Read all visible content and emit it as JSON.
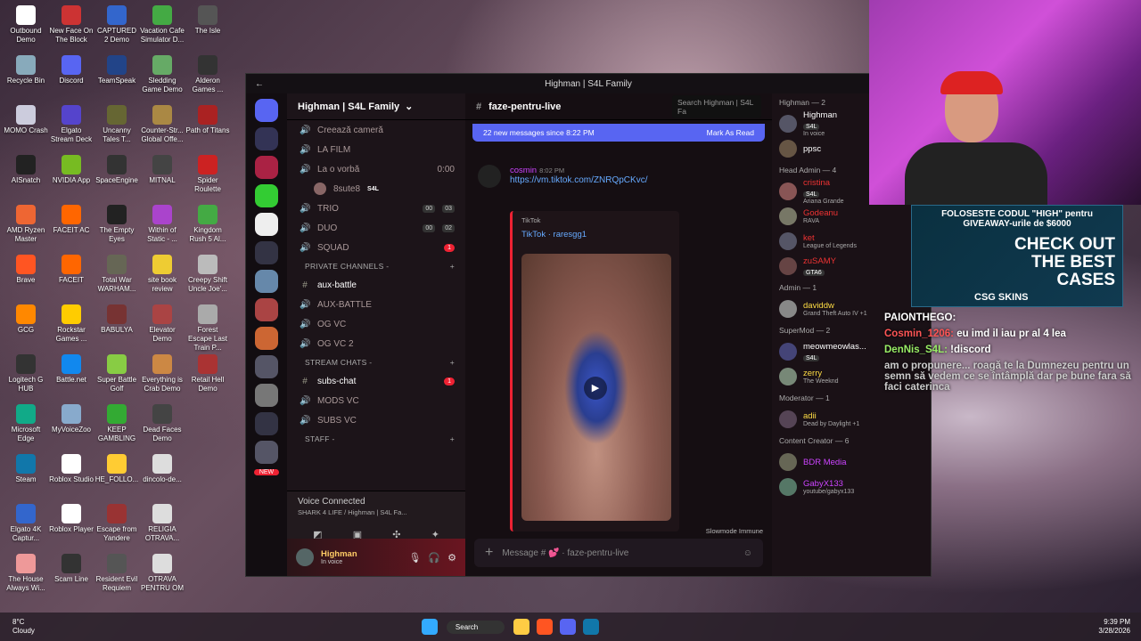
{
  "desktop": {
    "icons": [
      [
        "Outbound Demo",
        "#fff"
      ],
      [
        "New Face On The Block",
        "#c33"
      ],
      [
        "CAPTURED 2 Demo",
        "#36c"
      ],
      [
        "Vacation Cafe Simulator D...",
        "#4a4"
      ],
      [
        "The Isle",
        "#555"
      ],
      [
        "Recycle Bin",
        "#8ab"
      ],
      [
        "Discord",
        "#5865f2"
      ],
      [
        "TeamSpeak",
        "#248"
      ],
      [
        "Sledding Game Demo",
        "#6a6"
      ],
      [
        "Alderon Games ...",
        "#333"
      ],
      [
        "MOMO Crash",
        "#ccd"
      ],
      [
        "Elgato Stream Deck",
        "#54c"
      ],
      [
        "Uncanny Tales T...",
        "#663"
      ],
      [
        "Counter-Str... Global Offe...",
        "#a84"
      ],
      [
        "Path of Titans",
        "#a22"
      ],
      [
        "AISnatch",
        "#222"
      ],
      [
        "NVIDIA App",
        "#7b2"
      ],
      [
        "SpaceEngine",
        "#333"
      ],
      [
        "MITNAL",
        "#444"
      ],
      [
        "Spider Roulette",
        "#c22"
      ],
      [
        "AMD Ryzen Master",
        "#e63"
      ],
      [
        "FACEIT AC",
        "#f60"
      ],
      [
        "The Empty Eyes",
        "#222"
      ],
      [
        "Within of Static - ...",
        "#a4c"
      ],
      [
        "Kingdom Rush 5 Al...",
        "#4a4"
      ],
      [
        "Brave",
        "#f52"
      ],
      [
        "FACEIT",
        "#f60"
      ],
      [
        "Total War WARHAM...",
        "#665"
      ],
      [
        "site book review",
        "#ec3"
      ],
      [
        "Creepy Shift Uncle Joe'...",
        "#bbb"
      ],
      [
        "GCG",
        "#f80"
      ],
      [
        "Rockstar Games ...",
        "#fc0"
      ],
      [
        "BABULYA",
        "#733"
      ],
      [
        "Elevator Demo",
        "#a44"
      ],
      [
        "Forest Escape Last Train P...",
        "#aaa"
      ],
      [
        "Logitech G HUB",
        "#333"
      ],
      [
        "Battle.net",
        "#18e"
      ],
      [
        "Super Battle Golf",
        "#8c4"
      ],
      [
        "Everything is Crab Demo",
        "#c84"
      ],
      [
        "Retail Hell Demo",
        "#a33"
      ],
      [
        "Microsoft Edge",
        "#1a8"
      ],
      [
        "MyVoiceZoo",
        "#8ac"
      ],
      [
        "KEEP GAMBLING",
        "#3a3"
      ],
      [
        "Dead Faces Demo",
        "#444"
      ],
      [
        "",
        ""
      ],
      [
        "Steam",
        "#17a"
      ],
      [
        "Roblox Studio",
        "#fff"
      ],
      [
        "HE_FOLLO...",
        "#fc3"
      ],
      [
        "dincolo-de...",
        "#ddd"
      ],
      [
        "",
        ""
      ],
      [
        "Elgato 4K Captur...",
        "#36c"
      ],
      [
        "Roblox Player",
        "#fff"
      ],
      [
        "Escape from Yandere",
        "#933"
      ],
      [
        "RELIGIA OTRAVA...",
        "#ddd"
      ],
      [
        "",
        ""
      ],
      [
        "The House Always Wi...",
        "#e99"
      ],
      [
        "Scam Line",
        "#333"
      ],
      [
        "Resident Evil Requiem",
        "#555"
      ],
      [
        "OTRAVA PENTRU OM",
        "#ddd"
      ],
      [
        "",
        ""
      ]
    ]
  },
  "window": {
    "title": "Highman | S4L Family"
  },
  "server": {
    "name": "Highman | S4L Family",
    "new_label": "NEW"
  },
  "channels": [
    {
      "t": "ch",
      "name": "Creează cameră",
      "icon": "🔊"
    },
    {
      "t": "ch",
      "name": "LA FILM",
      "icon": "🔊"
    },
    {
      "t": "ch",
      "name": "La o vorbă",
      "icon": "🔊",
      "time": "0:00"
    },
    {
      "t": "user",
      "name": "8sute8",
      "tag": "S4L"
    },
    {
      "t": "ch",
      "name": "TRIO",
      "icon": "🔊",
      "p1": "00",
      "p2": "03"
    },
    {
      "t": "ch",
      "name": "DUO",
      "icon": "🔊",
      "p1": "00",
      "p2": "02"
    },
    {
      "t": "ch",
      "name": "SQUAD",
      "icon": "🔊",
      "badge": "1"
    },
    {
      "t": "cat",
      "name": "PRIVATE CHANNELS -"
    },
    {
      "t": "ch",
      "name": "aux-battle",
      "icon": "#",
      "bold": true
    },
    {
      "t": "ch",
      "name": "AUX-BATTLE",
      "icon": "🔊"
    },
    {
      "t": "ch",
      "name": "OG VC",
      "icon": "🔊"
    },
    {
      "t": "ch",
      "name": "OG VC 2",
      "icon": "🔊"
    },
    {
      "t": "cat",
      "name": "STREAM CHATS -"
    },
    {
      "t": "ch",
      "name": "subs-chat",
      "icon": "#",
      "bold": true,
      "badge": "1"
    },
    {
      "t": "ch",
      "name": "MODS VC",
      "icon": "🔊"
    },
    {
      "t": "ch",
      "name": "SUBS VC",
      "icon": "🔊"
    },
    {
      "t": "cat",
      "name": "STAFF -"
    }
  ],
  "voice": {
    "status": "Voice Connected",
    "detail": "SHARK 4 LIFE / Highman | S4L Fa..."
  },
  "me": {
    "name": "Highman",
    "status": "In voice"
  },
  "chat": {
    "channel": "faze-pentru-live",
    "search": "Search Highman | S4L Fa",
    "new_messages": "22 new messages since 8:22 PM",
    "mark_read": "Mark As Read",
    "author": "cosmin",
    "time": "8:02 PM",
    "link": "https://vm.tiktok.com/ZNRQpCKvc/",
    "embed_provider": "TikTok",
    "embed_title": "TikTok · raresgg1",
    "slowmode": "Slowmode Immune",
    "placeholder": "Message # 💕 · faze-pentru-live"
  },
  "members": [
    {
      "t": "h",
      "name": "Highman — 2"
    },
    {
      "name": "Highman",
      "sub": "In voice",
      "c": "#fff",
      "tag": "S4L"
    },
    {
      "name": "ppsc",
      "sub": "",
      "c": "#fff"
    },
    {
      "t": "h",
      "name": "Head Admin — 4"
    },
    {
      "name": "cristina",
      "sub": "Ariana Grande",
      "c": "#e33",
      "tag": "S4L"
    },
    {
      "name": "Godeanu",
      "sub": "RAVA",
      "c": "#e33"
    },
    {
      "name": "ket",
      "sub": "League of Legends",
      "c": "#e33"
    },
    {
      "name": "zuSAMY",
      "sub": "",
      "c": "#e33",
      "tag": "GTA6"
    },
    {
      "t": "h",
      "name": "Admin — 1"
    },
    {
      "name": "daviddw",
      "sub": "Grand Theft Auto IV +1",
      "c": "#fd4"
    },
    {
      "t": "h",
      "name": "SuperMod — 2"
    },
    {
      "name": "meowmeowlas...",
      "sub": "",
      "c": "#fff",
      "tag": "S4L"
    },
    {
      "name": "zerry",
      "sub": "The Weeknd",
      "c": "#fd4"
    },
    {
      "t": "h",
      "name": "Moderator — 1"
    },
    {
      "name": "adii",
      "sub": "Dead by Daylight +1",
      "c": "#fd4"
    },
    {
      "t": "h",
      "name": "Content Creator — 6"
    },
    {
      "name": "BDR Media",
      "sub": "",
      "c": "#c4f"
    },
    {
      "name": "GabyX133",
      "sub": "youtube/gabyx133",
      "c": "#c4f"
    }
  ],
  "stream": {
    "ad_line1": "FOLOSESTE CODUL \"HIGH\" pentru GIVEAWAY-urile de $6000",
    "ad_big": "CHECK OUT THE BEST CASES",
    "ad_brand": "CSG SKINS",
    "chat": [
      {
        "u": "PAIONTHEGO:",
        "m": "",
        "c": "#fff"
      },
      {
        "u": "Cosmin_1206:",
        "m": "eu imd il iau pr al 4 lea",
        "c": "#f55"
      },
      {
        "u": "DenNis_S4L:",
        "m": "!discord",
        "c": "#9e6"
      },
      {
        "u": "",
        "m": "am o propunere... roagă te la Dumnezeu pentru un semn să vedem ce se întâmplă dar pe bune fara să faci caterinca",
        "c": "#ccc"
      }
    ]
  },
  "taskbar": {
    "weather_temp": "8°C",
    "weather_desc": "Cloudy",
    "search": "Search",
    "time": "9:39 PM",
    "date": "3/28/2026"
  }
}
